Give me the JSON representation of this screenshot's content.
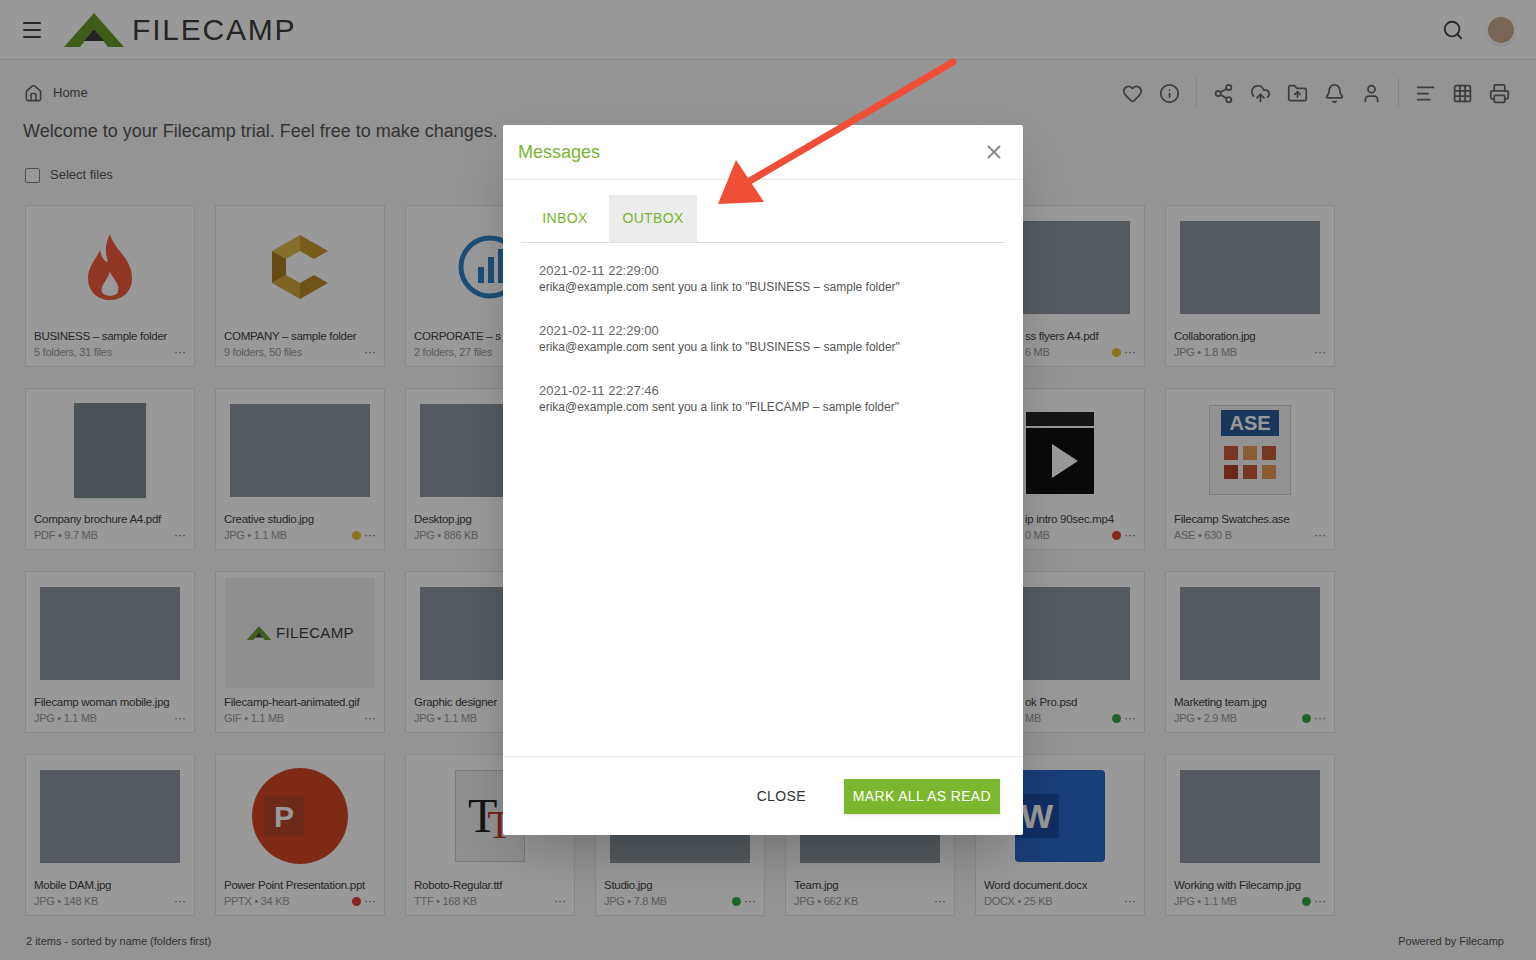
{
  "header": {
    "logo": "FILECAMP"
  },
  "breadcrumb": {
    "label": "Home"
  },
  "welcome": "Welcome to your Filecamp trial. Feel free to make changes.",
  "select": {
    "label": "Select files",
    "checked": false
  },
  "tiles": [
    [
      {
        "name": "BUSINESS – sample folder",
        "meta": "5 folders, 31 files",
        "kind": "fire",
        "more": "···"
      },
      {
        "name": "COMPANY – sample folder",
        "meta": "9 folders, 50 files",
        "kind": "company",
        "more": "···"
      },
      {
        "name": "CORPORATE – s",
        "meta": "2 folders, 27 files",
        "kind": "chart"
      },
      {},
      {},
      {
        "name": "ss flyers A4.pdf",
        "meta": "6 MB",
        "kind": "photo",
        "more": "···",
        "color": "#e6c229"
      },
      {
        "name": "Collaboration.jpg",
        "meta": "JPG • 1.8 MB",
        "kind": "photo",
        "more": "···"
      }
    ],
    [
      {
        "name": "Company brochure A4.pdf",
        "meta": "PDF • 9.7 MB",
        "kind": "cover",
        "more": "···"
      },
      {
        "name": "Creative studio.jpg",
        "meta": "JPG • 1.1 MB",
        "kind": "photo",
        "more": "···",
        "color": "#e6c229"
      },
      {
        "name": "Desktop.jpg",
        "meta": "JPG • 886 KB",
        "kind": "photo"
      },
      {},
      {},
      {
        "name": "ip intro 90sec.mp4",
        "meta": "0 MB",
        "kind": "clapper",
        "more": "···",
        "color": "#e0402f"
      },
      {
        "name": "Filecamp Swatches.ase",
        "meta": "ASE • 630 B",
        "kind": "ase",
        "glyph": "ASE",
        "more": "···"
      }
    ],
    [
      {
        "name": "Filecamp woman mobile.jpg",
        "meta": "JPG • 1.1 MB",
        "kind": "photo",
        "more": "···"
      },
      {
        "name": "Filecamp-heart-animated.gif",
        "meta": "GIF • 1.1 MB",
        "kind": "logo",
        "glyph": "FILECAMP",
        "more": "···"
      },
      {
        "name": "Graphic designer",
        "meta": "JPG • 1.1 MB",
        "kind": "photo"
      },
      {},
      {},
      {
        "name": "ok Pro.psd",
        "meta": "MB",
        "kind": "photo",
        "more": "···",
        "color": "#3aa64a"
      },
      {
        "name": "Marketing team.jpg",
        "meta": "JPG • 2.9 MB",
        "kind": "photo",
        "more": "···",
        "color": "#3aa64a"
      }
    ],
    [
      {
        "name": "Mobile DAM.jpg",
        "meta": "JPG • 148 KB",
        "kind": "photo",
        "more": "···"
      },
      {
        "name": "Power Point Presentation.ppt",
        "meta": "PPTX • 34 KB",
        "kind": "ppt",
        "glyph": "P",
        "more": "···",
        "color": "#e0402f"
      },
      {
        "name": "Roboto-Regular.ttf",
        "meta": "TTF • 168 KB",
        "kind": "font",
        "glyph": "T",
        "more": "···"
      },
      {
        "name": "Studio.jpg",
        "meta": "JPG • 7.8 MB",
        "kind": "photo",
        "more": "···",
        "color": "#3aa64a"
      },
      {
        "name": "Team.jpg",
        "meta": "JPG • 662 KB",
        "kind": "photo",
        "more": "···"
      },
      {
        "name": "Word document.docx",
        "meta": "DOCX • 25 KB",
        "kind": "word",
        "glyph": "W",
        "more": "···"
      },
      {
        "name": "Working with Filecamp.jpg",
        "meta": "JPG • 1.1 MB",
        "kind": "photo",
        "more": "···",
        "color": "#3aa64a"
      }
    ]
  ],
  "status_bar": {
    "left": "2 items - sorted by name (folders first)",
    "right": "Powered by Filecamp"
  },
  "dialog": {
    "title": "Messages",
    "tabs": [
      {
        "label": "INBOX",
        "selected": false
      },
      {
        "label": "OUTBOX",
        "selected": true
      }
    ],
    "messages": [
      {
        "time": "2021-02-11 22:29:00",
        "text": "erika@example.com sent you a link to \"BUSINESS – sample folder\""
      },
      {
        "time": "2021-02-11 22:29:00",
        "text": "erika@example.com sent you a link to \"BUSINESS – sample folder\""
      },
      {
        "time": "2021-02-11 22:27:46",
        "text": "erika@example.com sent you a link to \"FILECAMP – sample folder\""
      }
    ],
    "buttons": [
      {
        "label": "CLOSE",
        "primary": false
      },
      {
        "label": "MARK ALL AS READ",
        "primary": true
      }
    ]
  }
}
